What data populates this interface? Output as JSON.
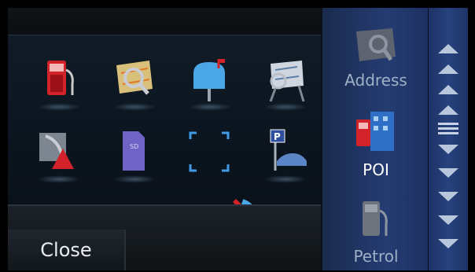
{
  "footer": {
    "close_label": "Close"
  },
  "side_menu": {
    "items": [
      {
        "label": "Address",
        "icon": "address-map-icon",
        "selected": false
      },
      {
        "label": "POI",
        "icon": "poi-icon",
        "selected": true
      },
      {
        "label": "Petrol",
        "icon": "petrol-pump-icon",
        "selected": false
      }
    ]
  },
  "grid_icons": [
    "petrol-pump-icon",
    "map-search-icon",
    "mailbox-icon",
    "map-easel-icon",
    "warning-road-icon",
    "sd-card-icon",
    "focus-frame-icon",
    "parking-icon",
    "phone-call-icon"
  ],
  "colors": {
    "panel_bg": "#0d1013",
    "side_bg": "#253c72",
    "label_active": "#ffffff",
    "label_inactive": "#9fb0c6",
    "accent_red": "#d9222a",
    "accent_blue": "#4aa6e6"
  }
}
